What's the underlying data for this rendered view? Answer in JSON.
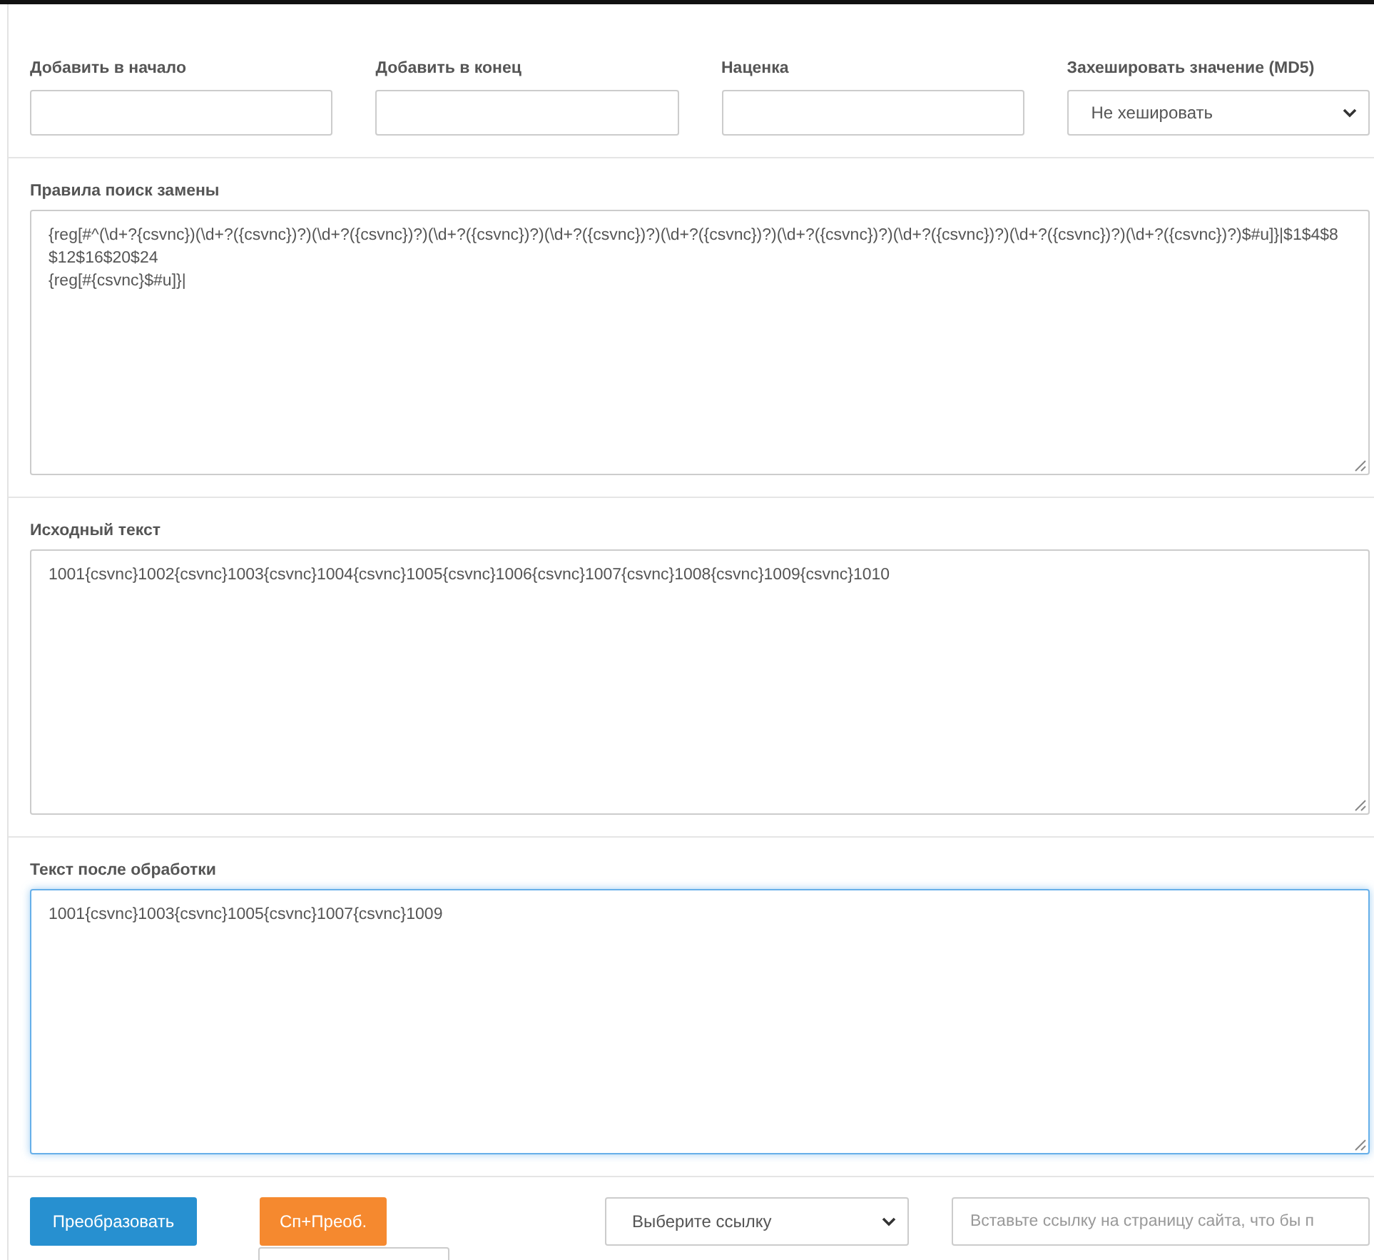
{
  "fields": [
    {
      "kind": "input",
      "label": "Добавить в начало"
    },
    {
      "kind": "input",
      "label": "Добавить в конец"
    },
    {
      "kind": "input",
      "label": "Наценка"
    },
    {
      "kind": "select",
      "label": "Захешировать значение (MD5)",
      "value": "Не хешировать"
    }
  ],
  "text_areas": [
    {
      "label": "Правила поиск замены",
      "focused": false,
      "lines": [
        "{reg[#^(\\d+?{csvnc})(\\d+?({csvnc})?)(\\d+?({csvnc})?)(\\d+?({csvnc})?)(\\d+?({csvnc})?)(\\d+?({csvnc})?)(\\d+?({csvnc})?)(\\d+?({csvnc})?)(\\d+?({csvnc})?)(\\d+?({csvnc})?)$#u]}|$1$4$8$12$16$20$24",
        "{reg[#{csvnc}$#u]}|"
      ]
    },
    {
      "label": "Исходный текст",
      "focused": false,
      "lines": [
        "1001{csvnc}1002{csvnc}1003{csvnc}1004{csvnc}1005{csvnc}1006{csvnc}1007{csvnc}1008{csvnc}1009{csvnc}1010"
      ]
    },
    {
      "label": "Текст после обработки",
      "focused": true,
      "lines": [
        "1001{csvnc}1003{csvnc}1005{csvnc}1007{csvnc}1009"
      ]
    }
  ],
  "actions": [
    {
      "kind": "primary",
      "label": "Преобразовать"
    },
    {
      "kind": "warning",
      "label": "Сп+Преоб."
    },
    {
      "kind": "select",
      "value": "Выберите ссылку"
    },
    {
      "kind": "input",
      "placeholder": "Вставьте ссылку на страницу сайта, что бы п"
    }
  ]
}
